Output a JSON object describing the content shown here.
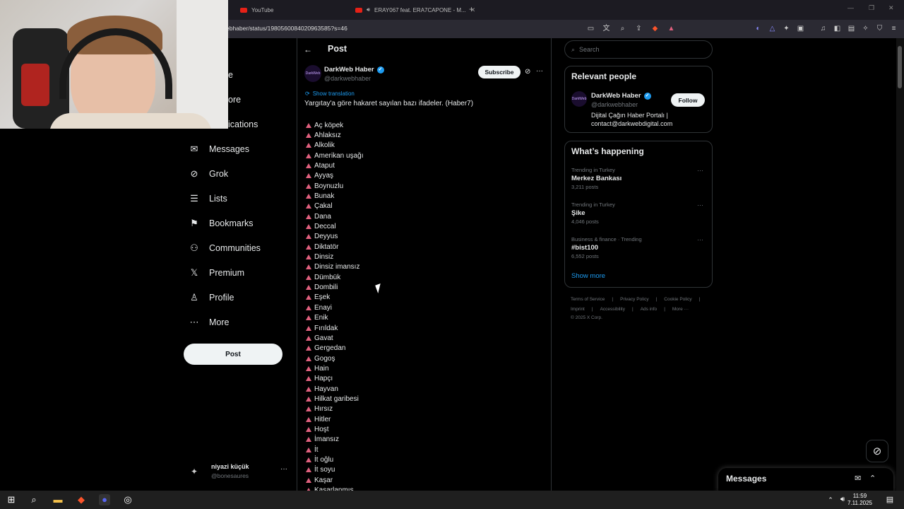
{
  "browser": {
    "tabs": [
      {
        "label": "YouTube"
      },
      {
        "label": "ERAY067 feat. ERA7CAPONE - M..."
      }
    ],
    "url": "ebhaber/status/1980560084020963585?s=46"
  },
  "sidebar": {
    "partial_items": [
      "e",
      "ore",
      "ications"
    ],
    "items": [
      {
        "label": "Messages",
        "icon": "mail-icon"
      },
      {
        "label": "Grok",
        "icon": "grok-icon"
      },
      {
        "label": "Lists",
        "icon": "list-icon"
      },
      {
        "label": "Bookmarks",
        "icon": "bookmark-icon"
      },
      {
        "label": "Communities",
        "icon": "communities-icon"
      },
      {
        "label": "Premium",
        "icon": "x-icon"
      },
      {
        "label": "Profile",
        "icon": "profile-icon"
      },
      {
        "label": "More",
        "icon": "more-circle-icon"
      }
    ],
    "post_button": "Post",
    "account": {
      "name": "niyazi küçük",
      "handle": "@bonesaures"
    }
  },
  "post": {
    "header_title": "Post",
    "author_name": "DarkWeb Haber",
    "author_handle": "@darkwebhaber",
    "subscribe_label": "Subscribe",
    "show_translation": "Show translation",
    "text": "Yargıtay'a göre hakaret sayılan bazı ifadeler. (Haber7)",
    "words": [
      "Aç köpek",
      "Ahlaksız",
      "Alkolik",
      "Amerikan uşağı",
      "Ataput",
      "Ayyaş",
      "Boynuzlu",
      "Bunak",
      "Çakal",
      "Dana",
      "Deccal",
      "Deyyus",
      "Diktatör",
      "Dinsiz",
      "Dinsiz imansız",
      "Dümbük",
      "Dombili",
      "Eşek",
      "Enayi",
      "Enik",
      "Fırıldak",
      "Gavat",
      "Gergedan",
      "Gogoş",
      "Hain",
      "Hapçı",
      "Hayvan",
      "Hilkat garibesi",
      "Hırsız",
      "Hitler",
      "Hoşt",
      "İmansız",
      "İt",
      "İt oğlu",
      "İt soyu",
      "Kaşar",
      "Kaşarlanmış"
    ]
  },
  "right": {
    "search_placeholder": "Search",
    "relevant_title": "Relevant people",
    "person": {
      "name": "DarkWeb Haber",
      "handle": "@darkwebhaber",
      "bio": "Dijital Çağın Haber Portalı | contact@darkwebdigital.com",
      "follow_label": "Follow"
    },
    "happening_title": "What’s happening",
    "trends": [
      {
        "meta": "Trending in Turkey",
        "topic": "Merkez Bankası",
        "count": "3,211 posts"
      },
      {
        "meta": "Trending in Turkey",
        "topic": "Şike",
        "count": "4,046 posts"
      },
      {
        "meta": "Business & finance · Trending",
        "topic": "#bist100",
        "count": "6,552 posts"
      }
    ],
    "show_more": "Show more",
    "footer_row1": [
      "Terms of Service",
      "|",
      "Privacy Policy",
      "|",
      "Cookie Policy",
      "|"
    ],
    "footer_row2": [
      "Imprint",
      "|",
      "Accessibility",
      "|",
      "Ads info",
      "|",
      "More ···"
    ],
    "footer_row3": "© 2025 X Corp."
  },
  "messages_drawer": {
    "title": "Messages"
  },
  "taskbar": {
    "time": "11:59",
    "date": "7.11.2025"
  },
  "colors": {
    "accent": "#1d9bf0",
    "triangle": "#e0607e",
    "background": "#000000"
  }
}
